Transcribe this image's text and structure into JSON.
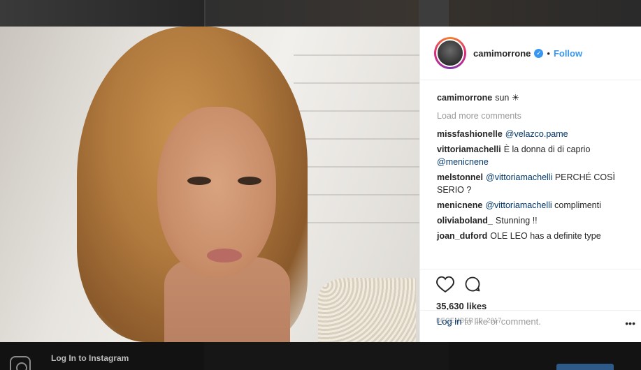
{
  "post": {
    "username": "camimorrone",
    "follow_label": "Follow",
    "separator": "•",
    "caption_author": "camimorrone",
    "caption_text": "sun ☀"
  },
  "comments": {
    "load_more": "Load more comments",
    "items": [
      {
        "author": "missfashionelle",
        "mention": "@velazco.pame",
        "text": ""
      },
      {
        "author": "vittoriamachelli",
        "mention": "",
        "text": "È la donna di di caprio",
        "mention_after": "@menicnene"
      },
      {
        "author": "melstonnel",
        "mention": "@vittoriamachelli",
        "text": "PERCHÉ COSÌ SERIO ?"
      },
      {
        "author": "menicnene",
        "mention": "@vittoriamachelli",
        "text": "complimenti"
      },
      {
        "author": "oliviaboland_",
        "mention": "",
        "text": "Stunning !!"
      },
      {
        "author": "joan_duford",
        "mention": "",
        "text": "OLE LEO has a definite type"
      }
    ]
  },
  "stats": {
    "likes": "35,630 likes",
    "date": "DECEMBER 10, 2017"
  },
  "login_row": {
    "link": "Log in",
    "text": "to like or comment.",
    "more": "•••"
  },
  "banner": {
    "text": "Log In to Instagram"
  },
  "icons": [
    "heart-icon",
    "comment-icon",
    "verified-badge-icon",
    "instagram-logo-icon",
    "more-options-icon"
  ],
  "colors": {
    "accent": "#3897f0",
    "mention": "#003569",
    "muted": "#999999"
  }
}
